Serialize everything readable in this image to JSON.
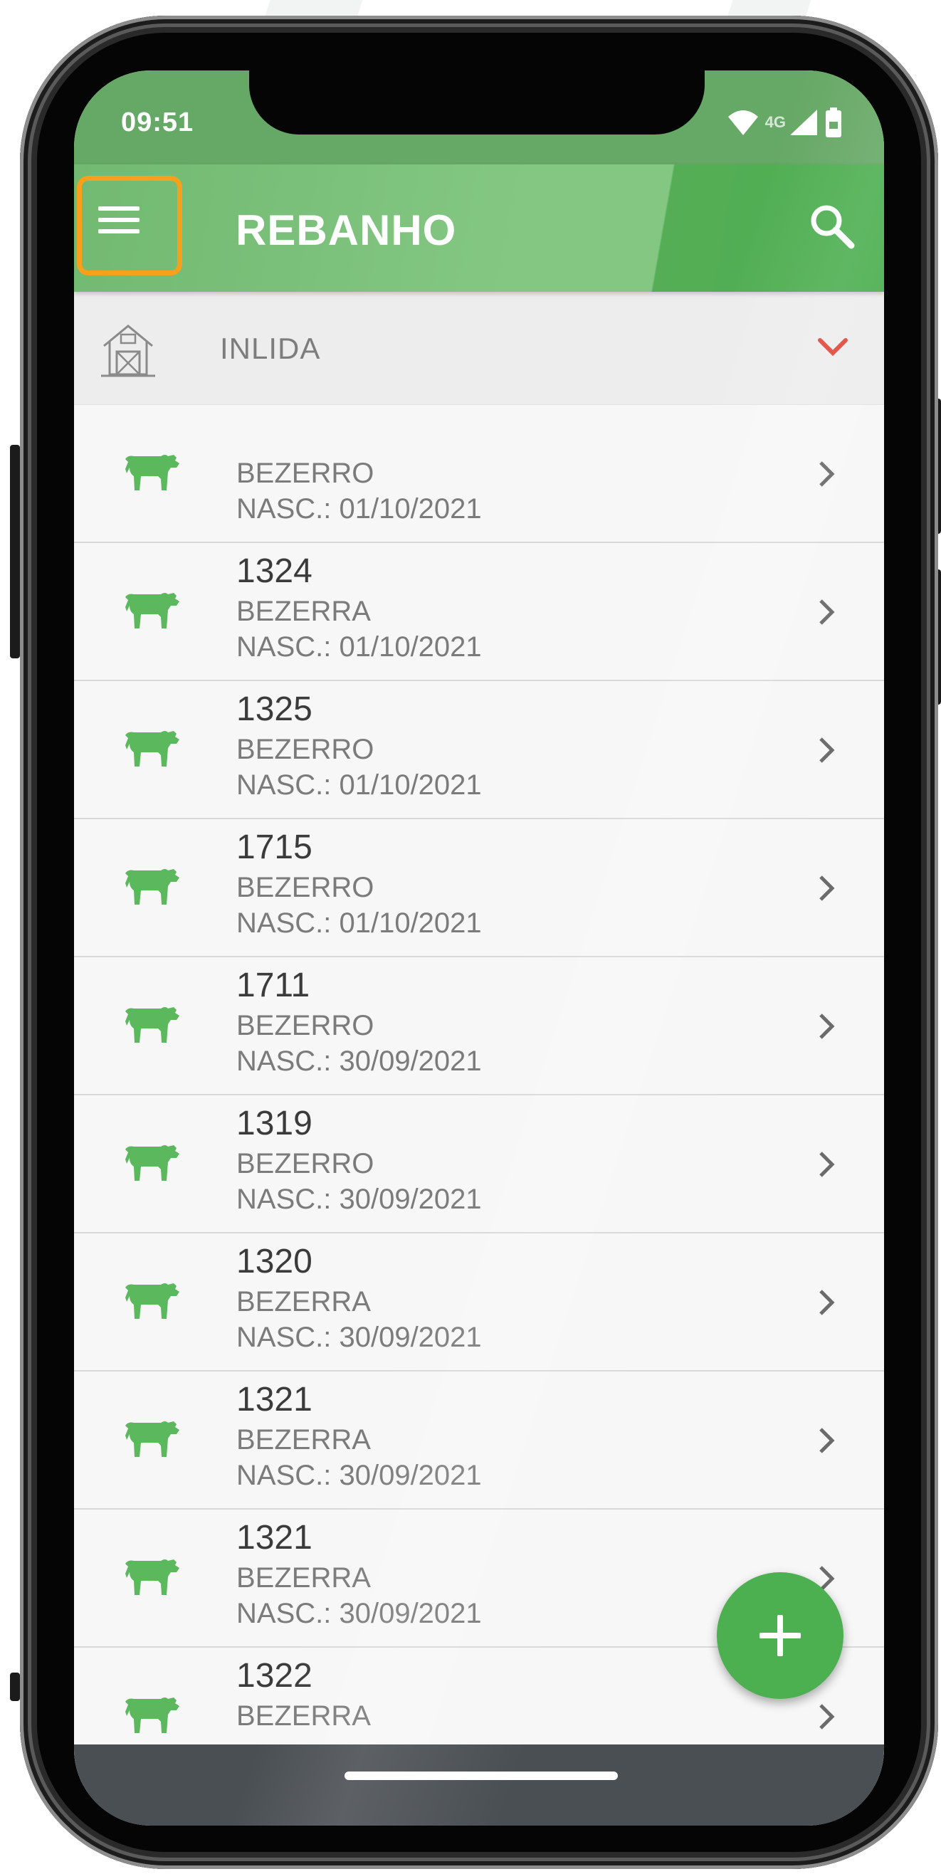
{
  "status_bar": {
    "time": "09:51",
    "network": "4G",
    "icons": [
      "wifi-icon",
      "cell-signal-icon",
      "battery-icon"
    ]
  },
  "app_bar": {
    "title": "REBANHO",
    "menu_icon": "hamburger-menu-icon",
    "search_icon": "search-icon"
  },
  "farm_selector": {
    "icon": "barn-icon",
    "name": "INLIDA",
    "chevron": "chevron-down-icon"
  },
  "animals": [
    {
      "id": "",
      "type": "BEZERRO",
      "birth": "NASC.: 01/10/2021"
    },
    {
      "id": "1324",
      "type": "BEZERRA",
      "birth": "NASC.: 01/10/2021"
    },
    {
      "id": "1325",
      "type": "BEZERRO",
      "birth": "NASC.: 01/10/2021"
    },
    {
      "id": "1715",
      "type": "BEZERRO",
      "birth": "NASC.: 01/10/2021"
    },
    {
      "id": "1711",
      "type": "BEZERRO",
      "birth": "NASC.: 30/09/2021"
    },
    {
      "id": "1319",
      "type": "BEZERRO",
      "birth": "NASC.: 30/09/2021"
    },
    {
      "id": "1320",
      "type": "BEZERRA",
      "birth": "NASC.: 30/09/2021"
    },
    {
      "id": "1321",
      "type": "BEZERRA",
      "birth": "NASC.: 30/09/2021"
    },
    {
      "id": "1321",
      "type": "BEZERRA",
      "birth": "NASC.: 30/09/2021"
    },
    {
      "id": "1322",
      "type": "BEZERRA",
      "birth": ""
    }
  ],
  "fab": {
    "icon": "plus-icon"
  },
  "colors": {
    "primary": "#4caf50",
    "app_bar": "#83c783",
    "status_bar": "#66a865",
    "highlight": "#f7a01c",
    "farm_chevron": "#e0473a",
    "nav_bar": "#4a4f54"
  }
}
